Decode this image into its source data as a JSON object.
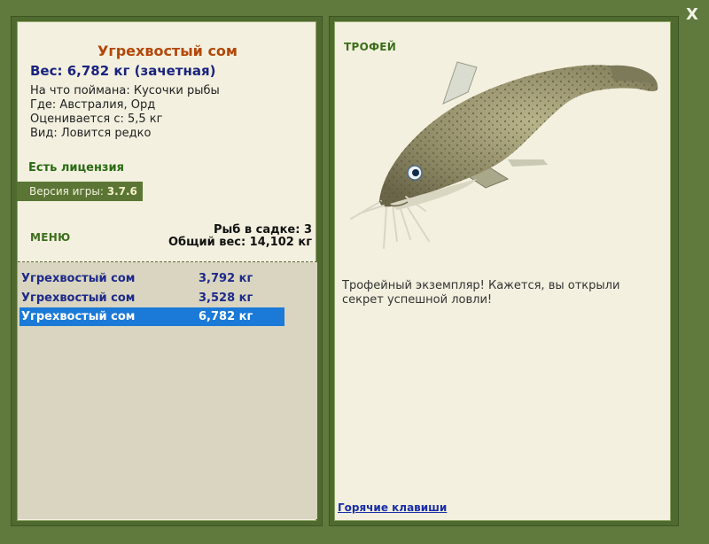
{
  "window": {
    "close_label": "X"
  },
  "fish": {
    "name": "Угрехвостый сом",
    "weight_line": "Вес: 6,782 кг (зачетная)",
    "caught_on": "На что поймана: Кусочки рыбы",
    "location": "Где: Австралия, Орд",
    "valued_from": "Оценивается с: 5,5 кг",
    "species_note": "Вид: Ловится редко"
  },
  "license": "Есть лицензия",
  "version": {
    "label": "Версия игры:",
    "value": "3.7.6"
  },
  "menu_label": "МЕНЮ",
  "keepnet": {
    "count_text": "Рыб в садке: 3",
    "total_text": "Общий вес: 14,102 кг",
    "items": [
      {
        "name": "Угрехвостый сом",
        "weight": "3,792 кг"
      },
      {
        "name": "Угрехвостый сом",
        "weight": "3,528 кг"
      },
      {
        "name": "Угрехвостый сом",
        "weight": "6,782 кг"
      }
    ],
    "selected_index": 2
  },
  "trophy": {
    "badge": "ТРОФЕЙ",
    "text": "Трофейный экземпляр! Кажется, вы открыли секрет успешной ловли!"
  },
  "hotkeys_label": "Горячие клавиши",
  "colors": {
    "background": "#5f7a3c",
    "panel": "#f3f0df",
    "title": "#b2480a",
    "selected_row": "#1b7ad8"
  }
}
